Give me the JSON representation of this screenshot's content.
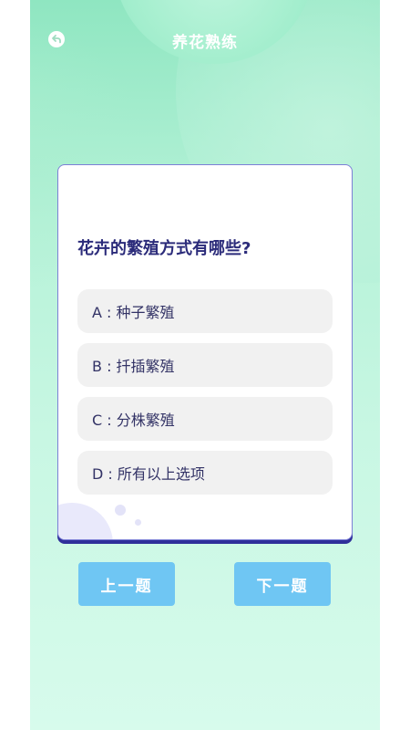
{
  "header": {
    "title": "养花熟练",
    "back_icon": "back-arrow-icon"
  },
  "quiz": {
    "question": "花卉的繁殖方式有哪些?",
    "options": [
      {
        "label": "A : 种子繁殖"
      },
      {
        "label": "B : 扦插繁殖"
      },
      {
        "label": "C : 分株繁殖"
      },
      {
        "label": "D : 所有以上选项"
      }
    ]
  },
  "navigation": {
    "prev_label": "上一题",
    "next_label": "下一题"
  },
  "colors": {
    "background_top": "#8fe6c1",
    "background_bottom": "#d7fbec",
    "card_border": "#7c7fd6",
    "question_text": "#2b2b7a",
    "option_background": "#f1f1f1",
    "nav_button": "#6fc6f3"
  }
}
